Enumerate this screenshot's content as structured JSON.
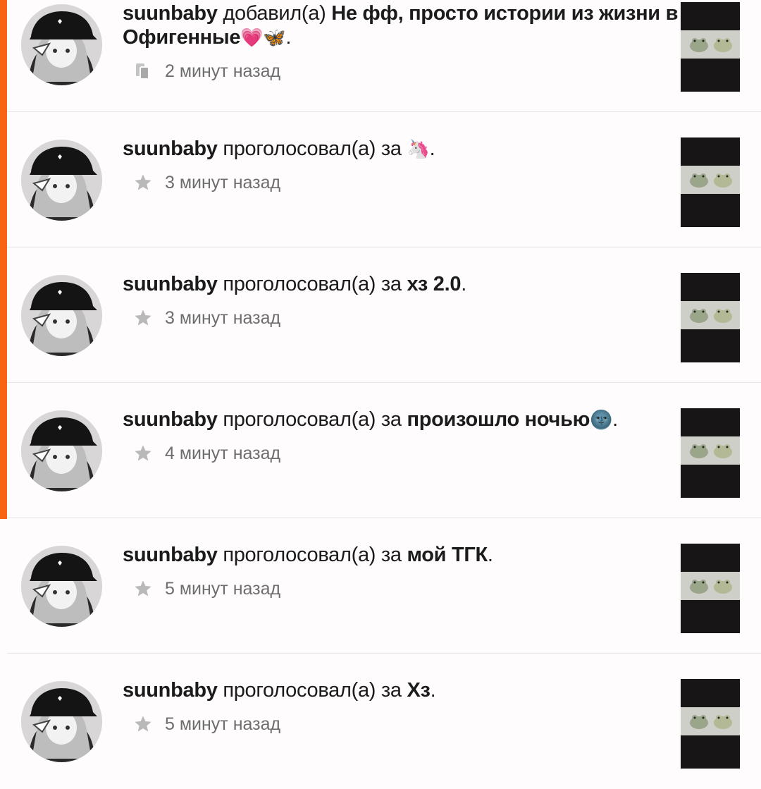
{
  "feed": {
    "items": [
      {
        "user": "suunbaby",
        "action": "добавил(а)",
        "target": "Не фф, просто истории из жизни в Офигенные",
        "emoji": "💗🦋",
        "end": ".",
        "icon": "copy-icon",
        "time": "2 минут назад"
      },
      {
        "user": "suunbaby",
        "action": "проголосовал(а) за",
        "target": "",
        "emoji": "🦄",
        "end": ".",
        "icon": "star-icon",
        "time": "3 минут назад"
      },
      {
        "user": "suunbaby",
        "action": "проголосовал(а) за",
        "target": "хз 2.0",
        "emoji": "",
        "end": ".",
        "icon": "star-icon",
        "time": "3 минут назад"
      },
      {
        "user": "suunbaby",
        "action": "проголосовал(а) за",
        "target": "произошло ночью",
        "emoji": "🌚",
        "end": ".",
        "icon": "star-icon",
        "time": "4 минут назад"
      },
      {
        "user": "suunbaby",
        "action": "проголосовал(а) за",
        "target": "мой ТГК",
        "emoji": "",
        "end": ".",
        "icon": "star-icon",
        "time": "5 минут назад"
      },
      {
        "user": "suunbaby",
        "action": "проголосовал(а) за",
        "target": "Хз",
        "emoji": "",
        "end": ".",
        "icon": "star-icon",
        "time": "5 минут назад"
      }
    ]
  },
  "colors": {
    "accent": "#f8640f",
    "background": "#fefcfd",
    "divider": "#e7e5e6",
    "meta_text": "#6e6e6e",
    "icon_gray": "#b9b9b9"
  }
}
